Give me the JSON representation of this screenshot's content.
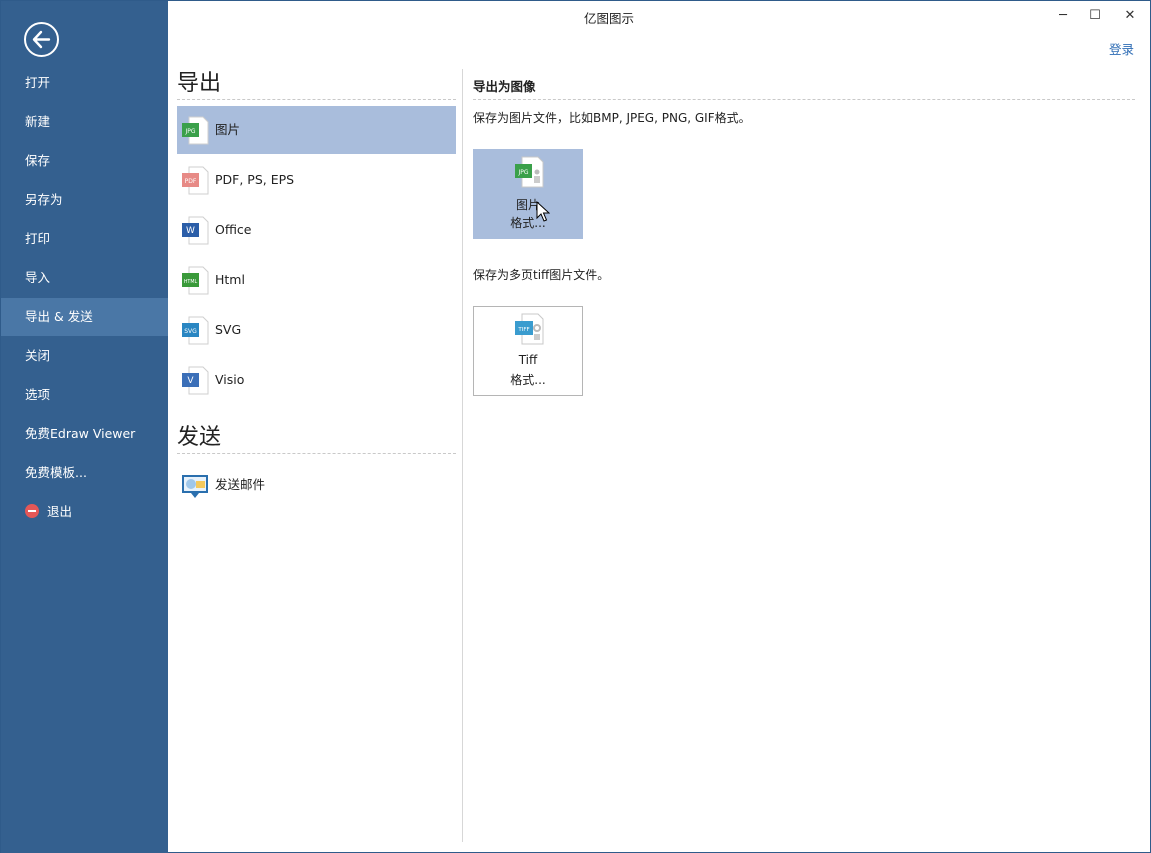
{
  "window": {
    "title": "亿图图示",
    "min_glyph": "─",
    "max_glyph": "☐",
    "close_glyph": "✕",
    "login": "登录"
  },
  "sidebar": {
    "items": [
      {
        "label": "打开"
      },
      {
        "label": "新建"
      },
      {
        "label": "保存"
      },
      {
        "label": "另存为"
      },
      {
        "label": "打印"
      },
      {
        "label": "导入"
      },
      {
        "label": "导出 & 发送",
        "active": true
      },
      {
        "label": "关闭"
      },
      {
        "label": "选项"
      },
      {
        "label": "免费Edraw Viewer"
      },
      {
        "label": "免费模板..."
      },
      {
        "label": "退出",
        "icon": "exit-icon"
      }
    ]
  },
  "middle": {
    "export_title": "导出",
    "export_items": [
      {
        "label": "图片",
        "icon": "jpg-file-icon",
        "badge": "JPG",
        "color": "#3aa04a",
        "active": true
      },
      {
        "label": "PDF, PS, EPS",
        "icon": "pdf-file-icon",
        "badge": "PDF",
        "color": "#e78a86"
      },
      {
        "label": "Office",
        "icon": "word-file-icon",
        "badge": "W",
        "color": "#2b5ea8"
      },
      {
        "label": "Html",
        "icon": "html-file-icon",
        "badge": "HTML",
        "color": "#3a9a3a"
      },
      {
        "label": "SVG",
        "icon": "svg-file-icon",
        "badge": "SVG",
        "color": "#2a86c2"
      },
      {
        "label": "Visio",
        "icon": "visio-file-icon",
        "badge": "V",
        "color": "#3b6fb8"
      }
    ],
    "send_title": "发送",
    "send_items": [
      {
        "label": "发送邮件",
        "icon": "send-mail-icon"
      }
    ]
  },
  "right": {
    "heading": "导出为图像",
    "desc_image": "保存为图片文件，比如BMP, JPEG, PNG, GIF格式。",
    "btn_image": {
      "line1": "图片",
      "line2": "格式...",
      "badge": "JPG"
    },
    "desc_tiff": "保存为多页tiff图片文件。",
    "btn_tiff": {
      "line1": "Tiff",
      "line2": "格式...",
      "badge": "TIFF"
    }
  },
  "colors": {
    "sidebar_bg": "#34608f",
    "sidebar_active": "#4a77a6",
    "selection": "#a9bddc",
    "link": "#2f6db5"
  }
}
